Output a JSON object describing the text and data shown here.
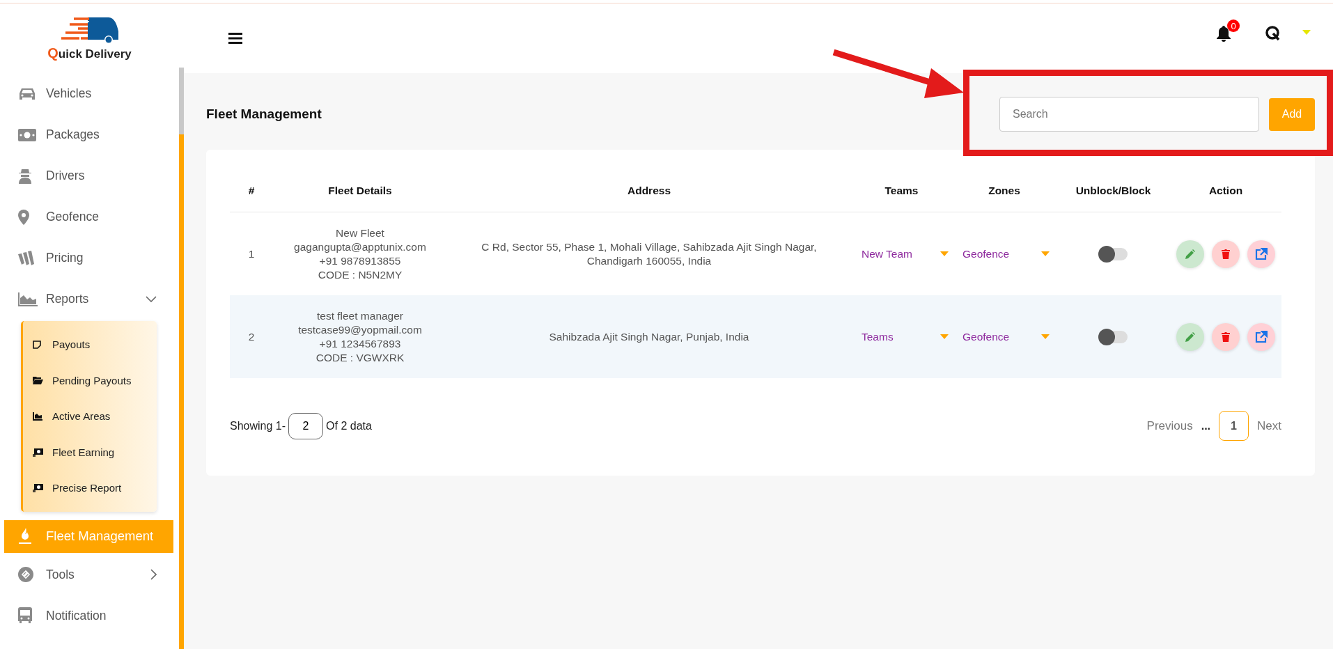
{
  "brand": {
    "name": "Quick Delivery"
  },
  "sidebar": {
    "items": [
      {
        "label": "Vehicles",
        "kind": "link",
        "selected": false
      },
      {
        "label": "Packages",
        "kind": "link",
        "selected": false
      },
      {
        "label": "Drivers",
        "kind": "link",
        "selected": false
      },
      {
        "label": "Geofence",
        "kind": "link",
        "selected": false
      },
      {
        "label": "Pricing",
        "kind": "link",
        "selected": false
      },
      {
        "label": "Reports",
        "kind": "group",
        "selected": false,
        "expanded": true,
        "children": [
          {
            "label": "Payouts"
          },
          {
            "label": "Pending Payouts"
          },
          {
            "label": "Active Areas"
          },
          {
            "label": "Fleet Earning"
          },
          {
            "label": "Precise Report"
          }
        ]
      },
      {
        "label": "Fleet Management",
        "kind": "link",
        "selected": true
      },
      {
        "label": "Tools",
        "kind": "group",
        "selected": false,
        "expanded": false
      },
      {
        "label": "Notification",
        "kind": "link",
        "selected": false
      }
    ]
  },
  "header": {
    "notification_count": "0"
  },
  "page": {
    "title": "Fleet Management",
    "search": {
      "placeholder": "Search"
    },
    "add_button": "Add"
  },
  "table": {
    "columns": [
      "#",
      "Fleet Details",
      "Address",
      "Teams",
      "Zones",
      "Unblock/Block",
      "Action"
    ],
    "rows": [
      {
        "number": "1",
        "fleet_details": [
          "New Fleet",
          "gagangupta@apptunix.com",
          "+91 9878913855",
          "CODE : N5N2MY"
        ],
        "address": "C Rd, Sector 55, Phase 1, Mohali Village, Sahibzada Ajit Singh Nagar, Chandigarh 160055, India",
        "team": "New Team",
        "zone": "Geofence",
        "blocked": false
      },
      {
        "number": "2",
        "fleet_details": [
          "test fleet manager",
          "testcase99@yopmail.com",
          "+91 1234567893",
          "CODE : VGWXRK"
        ],
        "address": "Sahibzada Ajit Singh Nagar, Punjab, India",
        "team": "Teams",
        "zone": "Geofence",
        "blocked": false
      }
    ]
  },
  "pagination": {
    "showing": "Showing 1-",
    "per_page": "2",
    "total": "Of 2 data",
    "previous": "Previous",
    "ellipsis": "...",
    "pages": [
      {
        "label": "1",
        "selected": true
      }
    ],
    "next": "Next"
  }
}
